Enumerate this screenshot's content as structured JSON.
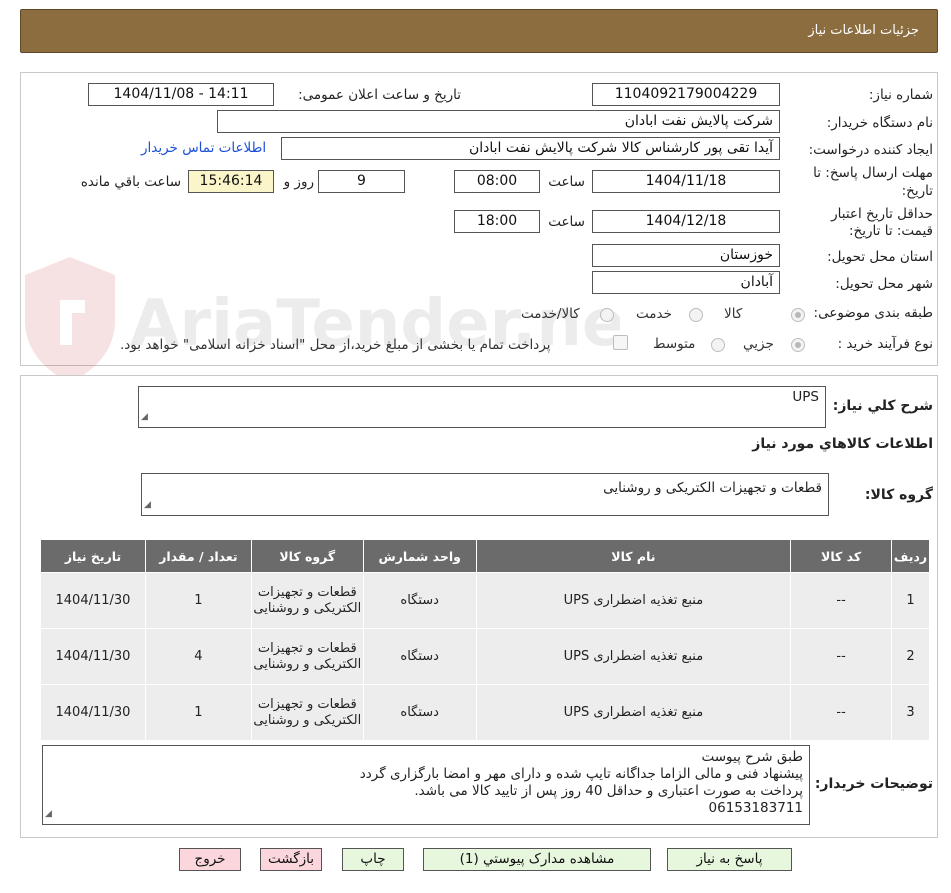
{
  "header": {
    "title": "جزئیات اطلاعات نیاز"
  },
  "watermark": {
    "text": "AriaTender.neT"
  },
  "form": {
    "need_number_label": "شماره نیاز:",
    "need_number": "1104092179004229",
    "announce_label": "تاریخ و ساعت اعلان عمومی:",
    "announce_value": "1404/11/08 - 14:11",
    "buyer_org_label": "نام دستگاه خریدار:",
    "buyer_org": "شرکت پالایش نفت ابادان",
    "creator_label": "ایجاد کننده درخواست:",
    "creator": "آیدا تقی پور کارشناس کالا شرکت پالایش نفت ابادان",
    "contact_link": "اطلاعات تماس خریدار",
    "deadline_label_1": "مهلت ارسال پاسخ: تا",
    "deadline_label_2": "تاریخ:",
    "deadline_date": "1404/11/18",
    "time_label": "ساعت",
    "deadline_time": "08:00",
    "days_value": "9",
    "days_label": "روز و",
    "remaining_time": "15:46:14",
    "remaining_label": "ساعت باقي مانده",
    "validity_label_1": "حداقل تاریخ اعتبار",
    "validity_label_2": "قیمت: تا تاریخ:",
    "validity_date": "1404/12/18",
    "validity_time": "18:00",
    "province_label": "استان محل تحویل:",
    "province": "خوزستان",
    "city_label": "شهر محل تحویل:",
    "city": "آبادان",
    "category_label": "طبقه بندی موضوعی:",
    "category_options": [
      "کالا",
      "خدمت",
      "کالا/خدمت"
    ],
    "process_label": "نوع فرآیند خرید :",
    "process_options": [
      "جزیي",
      "متوسط"
    ],
    "payment_note": "پرداخت تمام یا بخشی از مبلغ خرید،از محل \"اسناد خزانه اسلامی\" خواهد بود."
  },
  "details": {
    "summary_label": "شرح كلي نياز:",
    "summary": "UPS",
    "goods_info_title": "اطلاعات كالاهاي مورد نياز",
    "group_label": "گروه کالا:",
    "group_value": "قطعات و تجهیزات الکتریکی و روشنایی"
  },
  "table": {
    "headers": [
      "رديف",
      "كد كالا",
      "نام كالا",
      "واحد شمارش",
      "گروه كالا",
      "تعداد / مقدار",
      "تاريخ نياز"
    ],
    "rows": [
      [
        "1",
        "--",
        "منبع تغذیه اضطراری UPS",
        "دستگاه",
        "قطعات و تجهیزات الکتریکی و روشنایی",
        "1",
        "1404/11/30"
      ],
      [
        "2",
        "--",
        "منبع تغذیه اضطراری UPS",
        "دستگاه",
        "قطعات و تجهیزات الکتریکی و روشنایی",
        "4",
        "1404/11/30"
      ],
      [
        "3",
        "--",
        "منبع تغذیه اضطراری UPS",
        "دستگاه",
        "قطعات و تجهیزات الکتریکی و روشنایی",
        "1",
        "1404/11/30"
      ]
    ]
  },
  "buyer_notes": {
    "label": "توضیحات خریدار:",
    "lines": [
      "طبق شرح پیوست",
      "پیشنهاد فنی و مالی الزاما جداگانه تایپ شده و دارای مهر و امضا بارگزاری گردد",
      "پرداخت به صورت اعتباری و حداقل 40 روز پس از تایید کالا می باشد.",
      "06153183711"
    ]
  },
  "buttons": {
    "reply": "پاسخ به نیاز",
    "attachments": "مشاهده مدارک پیوستي (1)",
    "print": "چاپ",
    "back": "بازگشت",
    "exit": "خروج"
  },
  "colors": {
    "header_bg": "#8b6d3f",
    "table_header": "#6b6b6b",
    "link": "#1a4fd6"
  }
}
